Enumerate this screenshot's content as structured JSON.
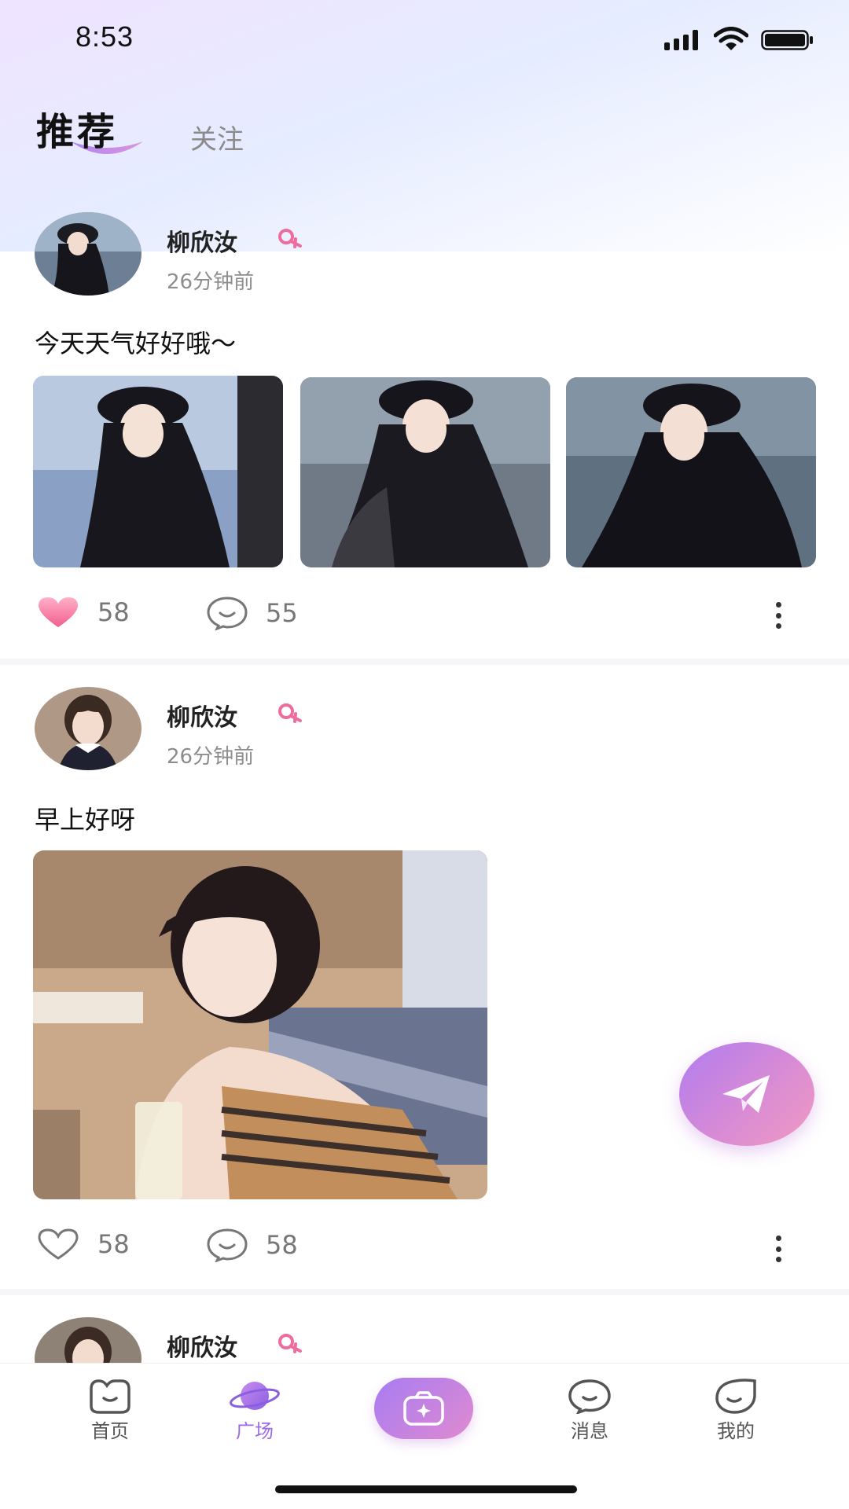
{
  "status_bar": {
    "time": "8:53"
  },
  "header": {
    "tab_recommend": "推荐",
    "tab_follow": "关注",
    "accent_color": "#a77cf2"
  },
  "posts": [
    {
      "username": "柳欣汝",
      "gender": "female",
      "time": "26分钟前",
      "text": "今天天气好好哦～",
      "likes": "58",
      "liked": true,
      "comments": "55",
      "images": [
        "woman-black-hat-1",
        "woman-black-hat-2",
        "woman-black-hat-3"
      ]
    },
    {
      "username": "柳欣汝",
      "gender": "female",
      "time": "26分钟前",
      "text": "早上好呀",
      "likes": "58",
      "liked": false,
      "comments": "58",
      "images": [
        "woman-striped-top-cafe"
      ]
    },
    {
      "username": "柳欣汝",
      "gender": "female"
    }
  ],
  "fab": {
    "icon": "paper-plane-icon"
  },
  "bottom_nav": {
    "items": [
      {
        "label": "首页",
        "icon": "home-face-icon",
        "active": false
      },
      {
        "label": "广场",
        "icon": "planet-icon",
        "active": true
      },
      {
        "label": "",
        "icon": "camera-icon",
        "active": false
      },
      {
        "label": "消息",
        "icon": "chat-bubble-icon",
        "active": false
      },
      {
        "label": "我的",
        "icon": "profile-face-icon",
        "active": false
      }
    ],
    "active_color": "#9b6be6"
  }
}
